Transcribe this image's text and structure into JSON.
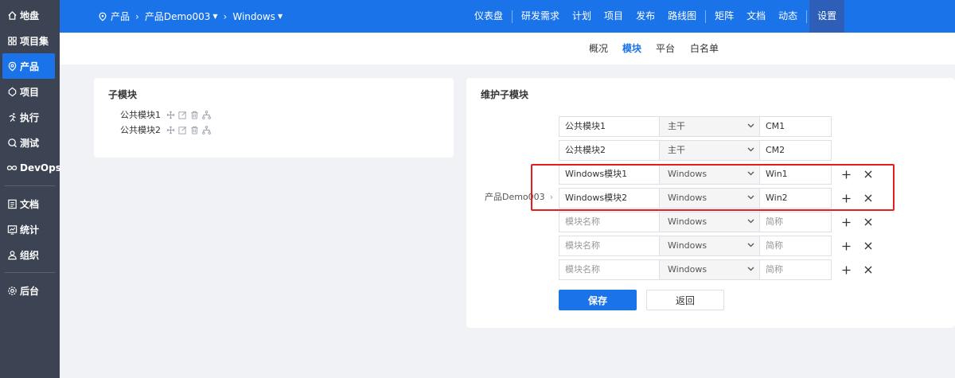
{
  "sidebar": {
    "items": [
      {
        "label": "地盘",
        "icon": "home-icon"
      },
      {
        "label": "项目集",
        "icon": "grid-icon"
      },
      {
        "label": "产品",
        "icon": "product-icon"
      },
      {
        "label": "项目",
        "icon": "project-icon"
      },
      {
        "label": "执行",
        "icon": "run-icon"
      },
      {
        "label": "测试",
        "icon": "test-icon"
      },
      {
        "label": "DevOps",
        "icon": "infinity-icon"
      },
      {
        "label": "文档",
        "icon": "doc-icon"
      },
      {
        "label": "统计",
        "icon": "chart-icon"
      },
      {
        "label": "组织",
        "icon": "users-icon"
      },
      {
        "label": "后台",
        "icon": "gear-icon"
      }
    ],
    "active": "产品"
  },
  "breadcrumb": {
    "root": "产品",
    "product": "产品Demo003",
    "branch": "Windows"
  },
  "topnav": [
    "仪表盘",
    "研发需求",
    "计划",
    "项目",
    "发布",
    "路线图",
    "矩阵",
    "文档",
    "动态",
    "设置"
  ],
  "subnav": {
    "tabs": [
      "概况",
      "模块",
      "平台",
      "白名单"
    ],
    "active": "模块"
  },
  "left_card": {
    "title": "子模块",
    "items": [
      "公共模块1",
      "公共模块2"
    ]
  },
  "right_card": {
    "title": "维护子模块",
    "parent": "产品Demo003",
    "rows": [
      {
        "name": "公共模块1",
        "branch": "主干",
        "code": "CM1",
        "placeholder": false,
        "actions": false
      },
      {
        "name": "公共模块2",
        "branch": "主干",
        "code": "CM2",
        "placeholder": false,
        "actions": false
      },
      {
        "name": "Windows模块1",
        "branch": "Windows",
        "code": "Win1",
        "placeholder": false,
        "actions": true
      },
      {
        "name": "Windows模块2",
        "branch": "Windows",
        "code": "Win2",
        "placeholder": false,
        "actions": true
      },
      {
        "name": "模块名称",
        "branch": "Windows",
        "code": "简称",
        "placeholder": true,
        "actions": true
      },
      {
        "name": "模块名称",
        "branch": "Windows",
        "code": "简称",
        "placeholder": true,
        "actions": true
      },
      {
        "name": "模块名称",
        "branch": "Windows",
        "code": "简称",
        "placeholder": true,
        "actions": true
      }
    ],
    "save_label": "保存",
    "back_label": "返回"
  },
  "colors": {
    "primary": "#1a73e8",
    "sidebar_bg": "#3c4353",
    "highlight_red": "#e21e1e"
  }
}
